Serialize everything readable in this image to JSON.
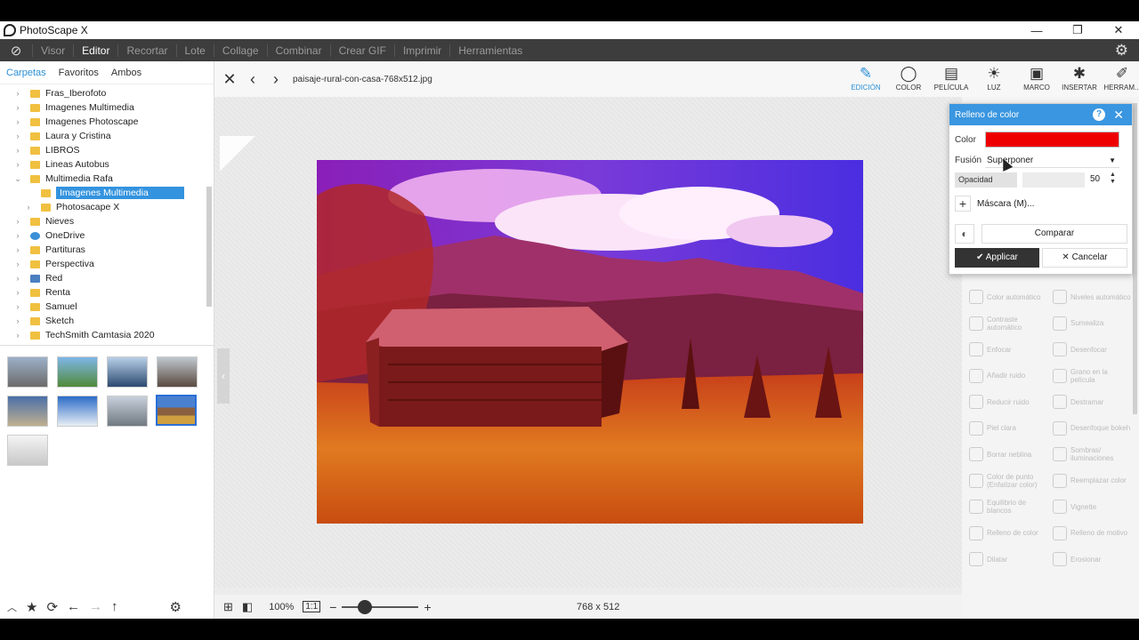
{
  "window": {
    "title": "PhotoScape X",
    "minimize": "—",
    "restore": "❐",
    "close": "✕"
  },
  "menu": {
    "items": [
      "Visor",
      "Editor",
      "Recortar",
      "Lote",
      "Collage",
      "Combinar",
      "Crear GIF",
      "Imprimir",
      "Herramientas"
    ],
    "active": "Editor"
  },
  "left_tabs": [
    "Carpetas",
    "Favoritos",
    "Ambos"
  ],
  "tree": [
    {
      "label": "Fras_Iberofoto",
      "icon": "folder",
      "indent": 0,
      "arrow": "›"
    },
    {
      "label": "Imagenes Multimedia",
      "icon": "folder",
      "indent": 0,
      "arrow": "›"
    },
    {
      "label": "Imagenes Photoscape",
      "icon": "folder",
      "indent": 0,
      "arrow": "›"
    },
    {
      "label": "Laura y Cristina",
      "icon": "folder",
      "indent": 0,
      "arrow": "›"
    },
    {
      "label": "LIBROS",
      "icon": "folder",
      "indent": 0,
      "arrow": "›"
    },
    {
      "label": "Lineas Autobus",
      "icon": "folder",
      "indent": 0,
      "arrow": "›"
    },
    {
      "label": "Multimedia Rafa",
      "icon": "folder",
      "indent": 0,
      "arrow": "⌄"
    },
    {
      "label": "Imagenes Multimedia",
      "icon": "folder",
      "indent": 1,
      "arrow": "",
      "selected": true
    },
    {
      "label": "Photosacape X",
      "icon": "folder",
      "indent": 1,
      "arrow": "›"
    },
    {
      "label": "Nieves",
      "icon": "folder",
      "indent": 0,
      "arrow": "›"
    },
    {
      "label": "OneDrive",
      "icon": "cloud",
      "indent": 0,
      "arrow": "›"
    },
    {
      "label": "Partituras",
      "icon": "folder",
      "indent": 0,
      "arrow": "›"
    },
    {
      "label": "Perspectiva",
      "icon": "folder",
      "indent": 0,
      "arrow": "›"
    },
    {
      "label": "Red",
      "icon": "net",
      "indent": 0,
      "arrow": "›"
    },
    {
      "label": "Renta",
      "icon": "folder",
      "indent": 0,
      "arrow": "›"
    },
    {
      "label": "Samuel",
      "icon": "folder",
      "indent": 0,
      "arrow": "›"
    },
    {
      "label": "Sketch",
      "icon": "folder",
      "indent": 0,
      "arrow": "›"
    },
    {
      "label": "TechSmith Camtasia 2020",
      "icon": "folder",
      "indent": 0,
      "arrow": "›"
    }
  ],
  "editor": {
    "filename": "paisaje-rural-con-casa-768x512.jpg",
    "zoom": "100%",
    "ratio": "1:1",
    "dimensions": "768 x 512"
  },
  "tools": [
    {
      "label": "EDICIÓN",
      "icon": "edit-icon",
      "glyph": "✎",
      "active": true
    },
    {
      "label": "COLOR",
      "icon": "color-icon",
      "glyph": "◯"
    },
    {
      "label": "PELÍCULA",
      "icon": "film-icon",
      "glyph": "▤"
    },
    {
      "label": "LUZ",
      "icon": "light-icon",
      "glyph": "☀"
    },
    {
      "label": "MARCO",
      "icon": "frame-icon",
      "glyph": "▣"
    },
    {
      "label": "INSERTAR",
      "icon": "insert-icon",
      "glyph": "✱"
    },
    {
      "label": "HERRAM...",
      "icon": "tools-icon",
      "glyph": "✐"
    }
  ],
  "adjustments": [
    [
      "Color automático",
      "Niveles automático"
    ],
    [
      "Contraste automático",
      "Sumealiza"
    ],
    [
      "Enfocar",
      "Desenfocar"
    ],
    [
      "Añadir ruido",
      "Grano en la película"
    ],
    [
      "Reducir ruido",
      "Destramar"
    ],
    [
      "Piel clara",
      "Desenfoque bokeh"
    ],
    [
      "Borrar neblina",
      "Sombras/ iluminaciones"
    ],
    [
      "Color de punto (Enfatizar color)",
      "Reemplazar color"
    ],
    [
      "Equilibrio de blancos",
      "Vignette"
    ],
    [
      "Relleno de color",
      "Relleno de motivo"
    ],
    [
      "Dilatar",
      "Erosionar"
    ]
  ],
  "dialog": {
    "title": "Relleno de color",
    "help": "?",
    "color_label": "Color",
    "color_value": "#ee0000",
    "fusion_label": "Fusión",
    "fusion_value": "Superponer",
    "opacity_label": "Opacidad",
    "opacity_value": "50",
    "mask_label": "Máscara (M)...",
    "compare_label": "Comparar",
    "apply_label": "Applicar",
    "cancel_label": "Cancelar"
  },
  "colors": {
    "accent": "#2a8fd6",
    "menubar": "#3d3d3d",
    "dialog_head": "#3a96e0"
  }
}
